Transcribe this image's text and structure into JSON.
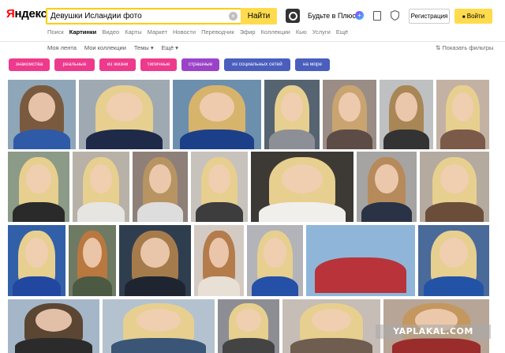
{
  "header": {
    "logo": {
      "first_letter": "Я",
      "rest": "ндекс"
    },
    "search": {
      "value": "Девушки Исландии фото",
      "button_label": "Найти",
      "clear_glyph": "×"
    },
    "plus_promo": "Будьте в Плюсе",
    "plus_badge_glyph": "+",
    "register_label": "Регистрация",
    "login_label": "Войти",
    "login_icon_glyph": "■"
  },
  "services": [
    {
      "label": "Поиск",
      "active": false
    },
    {
      "label": "Картинки",
      "active": true
    },
    {
      "label": "Видео",
      "active": false
    },
    {
      "label": "Карты",
      "active": false
    },
    {
      "label": "Маркет",
      "active": false
    },
    {
      "label": "Новости",
      "active": false
    },
    {
      "label": "Переводчик",
      "active": false
    },
    {
      "label": "Эфир",
      "active": false
    },
    {
      "label": "Коллекции",
      "active": false
    },
    {
      "label": "Кью",
      "active": false
    },
    {
      "label": "Услуги",
      "active": false
    },
    {
      "label": "Ещё",
      "active": false
    }
  ],
  "subnav": {
    "my_feed": "Моя лента",
    "my_collections": "Мои коллекции",
    "topics": "Темы",
    "more": "Ещё",
    "dropdown_glyph": "▾",
    "filters_toggle": "Показать фильтры",
    "filters_glyph": "⇅"
  },
  "chips": [
    {
      "label": "знакомства",
      "color": "#ee3a8c"
    },
    {
      "label": "реальные",
      "color": "#ee3a8c"
    },
    {
      "label": "из жизни",
      "color": "#ee3a8c"
    },
    {
      "label": "типичные",
      "color": "#ee3a8c"
    },
    {
      "label": "страшные",
      "color": "#9b43c8"
    },
    {
      "label": "из социальных сетей",
      "color": "#4a5ebd"
    },
    {
      "label": "на море",
      "color": "#4a5ebd"
    }
  ],
  "colors": {
    "accent": "#ffdb4d",
    "search_border": "#ffcc00",
    "logo_red": "#ff0000"
  },
  "watermark": "YAPLAKAL.COM"
}
